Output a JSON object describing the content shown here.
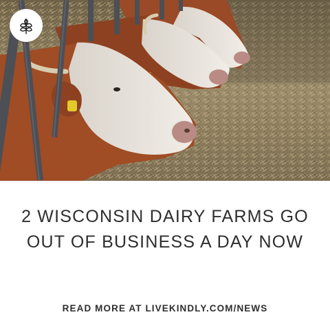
{
  "logo": {
    "icon": "sprout-leaf-icon"
  },
  "headline": {
    "line1": "2 WISCONSIN DAIRY FARMS GO",
    "line2": "OUT OF BUSINESS A DAY NOW"
  },
  "cta": {
    "text": "READ MORE AT LIVEKINDLY.COM/NEWS"
  },
  "colors": {
    "text": "#2e2e2e",
    "background": "#ffffff",
    "hay": "#8a7a5c",
    "cow_brown": "#9a4a26",
    "cow_white": "#ece8e2"
  }
}
